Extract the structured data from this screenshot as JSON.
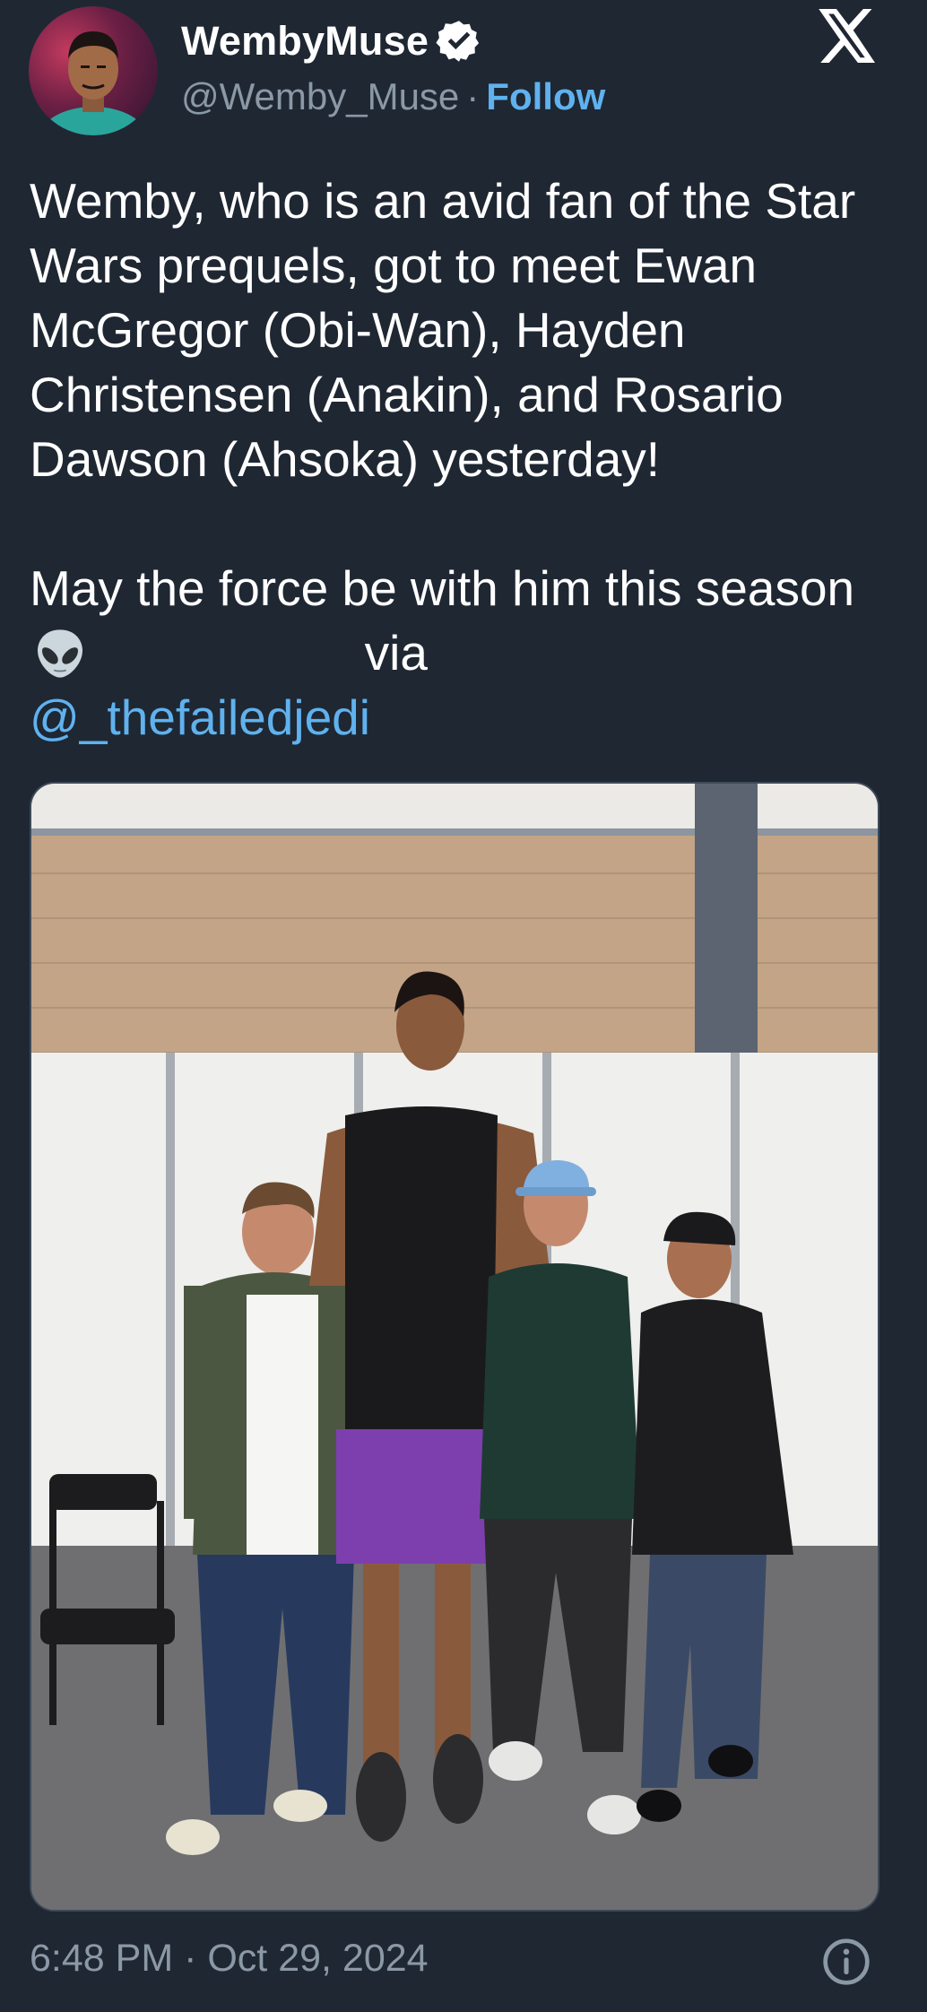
{
  "author": {
    "display_name": "WembyMuse",
    "handle": "@Wemby_Muse",
    "separator": "·",
    "follow_label": "Follow",
    "verified": true
  },
  "tweet": {
    "text_main": "Wemby, who is an avid fan of the Star Wars prequels, got to meet Ewan McGregor (Obi-Wan), Hayden Christensen (Anakin), and Rosario Dawson (Ahsoka) yesterday!",
    "text_line2_start": "May the force be with him this season",
    "text_via": "via",
    "mention": "@_thefailedjedi",
    "emoji": "alien-emoji"
  },
  "footer": {
    "timestamp": "6:48 PM · Oct 29, 2024"
  },
  "icons": {
    "verified": "verified-badge-icon",
    "logo": "x-logo-icon",
    "info": "info-icon"
  },
  "colors": {
    "background": "#1f2733",
    "link": "#5fb2ee",
    "secondary_text": "#8b98a5"
  }
}
